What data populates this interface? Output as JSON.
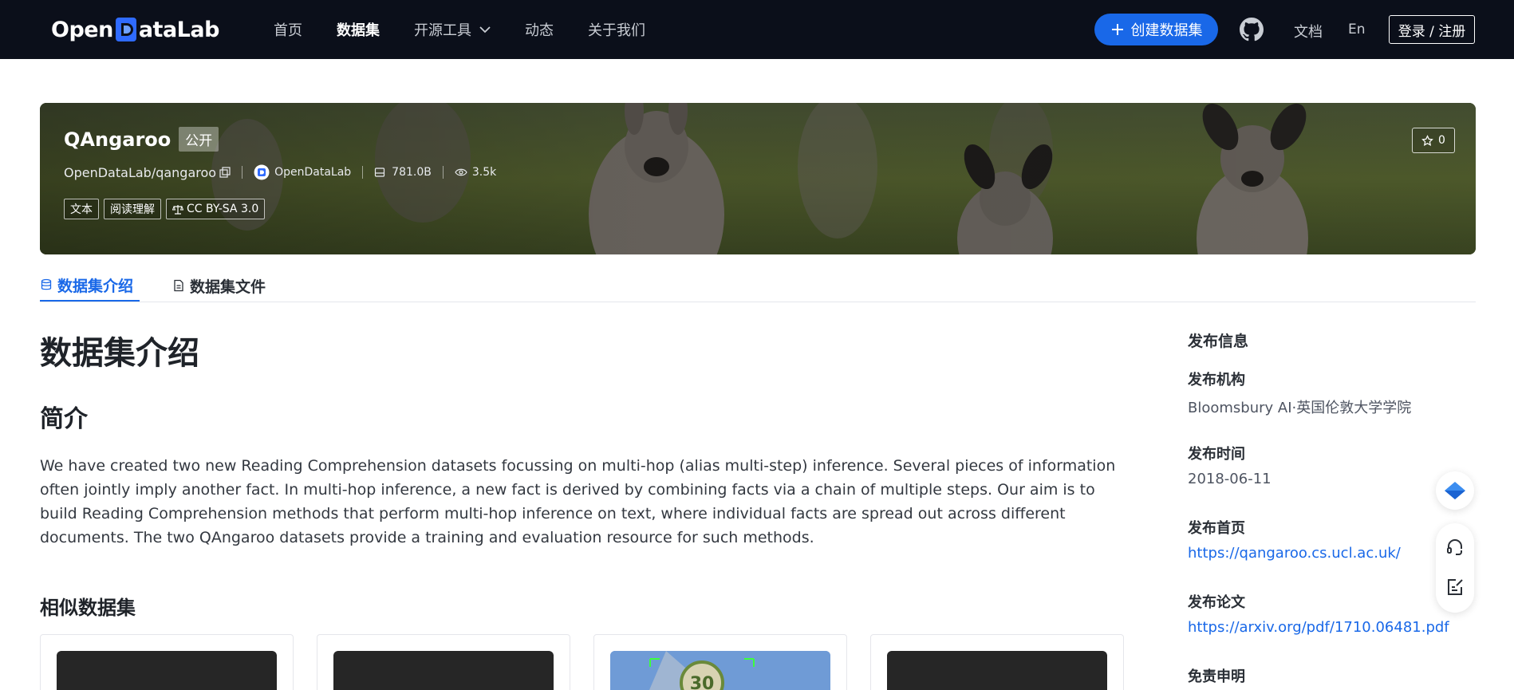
{
  "nav": {
    "logo": {
      "before": "Open",
      "after": "ataLab"
    },
    "links": [
      "首页",
      "数据集",
      "开源工具",
      "动态",
      "关于我们"
    ],
    "active_index": 1,
    "create_label": "创建数据集",
    "docs_label": "文档",
    "lang_label": "En",
    "login_label": "登录 / 注册"
  },
  "dataset": {
    "title": "QAngaroo",
    "visibility": "公开",
    "repo": "OpenDataLab/qangaroo",
    "owner": "OpenDataLab",
    "size": "781.0B",
    "views": "3.5k",
    "tags": [
      "文本",
      "阅读理解",
      "CC BY-SA 3.0"
    ],
    "stars": "0"
  },
  "tabs": [
    "数据集介绍",
    "数据集文件"
  ],
  "main": {
    "heading": "数据集介绍",
    "intro_heading": "简介",
    "intro_text": "We have created two new Reading Comprehension datasets focussing on multi-hop (alias multi-step) inference. Several pieces of information often jointly imply another fact. In multi-hop inference, a new fact is derived by combining facts via a chain of multiple steps. Our aim is to build Reading Comprehension methods that perform multi-hop inference on text, where individual facts are spread out across different documents. The two QAngaroo datasets provide a training and evaluation resource for such methods.",
    "similar_heading": "相似数据集"
  },
  "sidebar": {
    "heading": "发布信息",
    "org_label": "发布机构",
    "org_value": "Bloomsbury AI·英国伦敦大学学院",
    "date_label": "发布时间",
    "date_value": "2018-06-11",
    "home_label": "发布首页",
    "home_value": "https://qangaroo.cs.ucl.ac.uk/",
    "paper_label": "发布论文",
    "paper_value": "https://arxiv.org/pdf/1710.06481.pdf",
    "disclaimer_label": "免责申明"
  },
  "colors": {
    "accent": "#1968e8",
    "nav_bg": "#0b0f1a"
  }
}
